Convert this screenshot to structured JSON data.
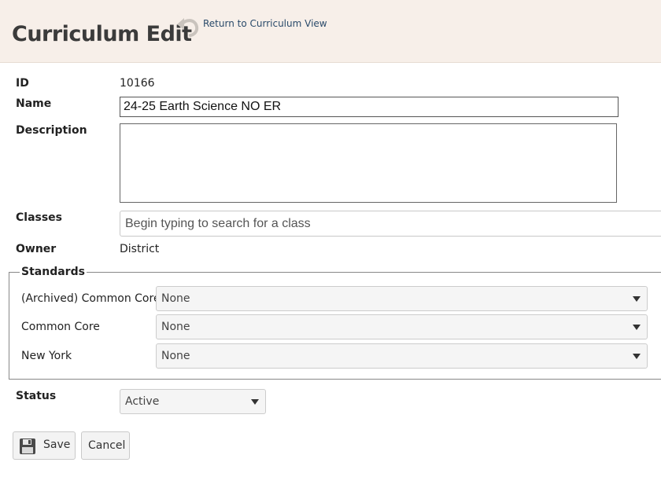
{
  "header": {
    "title": "Curriculum Edit",
    "return_link": "Return to Curriculum View"
  },
  "form": {
    "id_label": "ID",
    "id_value": "10166",
    "name_label": "Name",
    "name_value": "24-25 Earth Science NO ER",
    "description_label": "Description",
    "description_value": "",
    "classes_label": "Classes",
    "classes_placeholder": "Begin typing to search for a class",
    "owner_label": "Owner",
    "owner_value": "District",
    "status_label": "Status",
    "status_value": "Active"
  },
  "standards": {
    "legend": "Standards",
    "rows": [
      {
        "label": "(Archived) Common Core",
        "value": "None"
      },
      {
        "label": "Common Core",
        "value": "None"
      },
      {
        "label": "New York",
        "value": "None"
      }
    ]
  },
  "actions": {
    "save_label": "Save",
    "cancel_label": "Cancel"
  },
  "icons": {
    "return": "undo-arrow-icon",
    "save": "floppy-disk-icon"
  }
}
